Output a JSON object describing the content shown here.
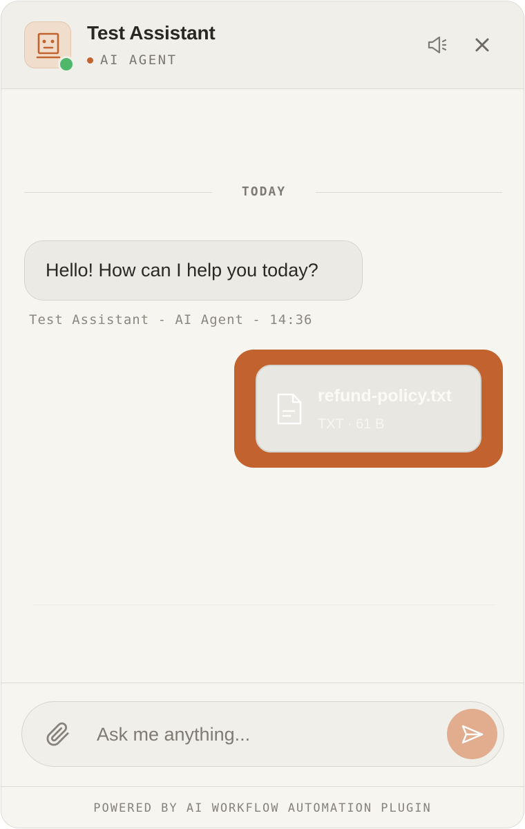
{
  "header": {
    "title": "Test Assistant",
    "subtitle": "AI AGENT",
    "icons": {
      "avatar": "robot-icon",
      "speaker": "speaker-icon",
      "close": "close-icon"
    }
  },
  "messages": {
    "divider_label": "TODAY",
    "agent_message": "Hello! How can I help you today?",
    "agent_meta": "Test Assistant - AI Agent - 14:36",
    "user_attachment": {
      "file_name": "refund-policy.txt",
      "file_meta": "TXT · 61 B",
      "icon": "document-icon"
    }
  },
  "composer": {
    "placeholder": "Ask me anything...",
    "value": "",
    "icons": {
      "attach": "paperclip-icon",
      "send": "send-icon"
    }
  },
  "footer": {
    "text": "POWERED BY AI WORKFLOW AUTOMATION PLUGIN"
  },
  "colors": {
    "accent": "#c1622f",
    "online": "#4fb86a",
    "background": "#f6f5ef",
    "send_button": "#e2ad8f"
  }
}
